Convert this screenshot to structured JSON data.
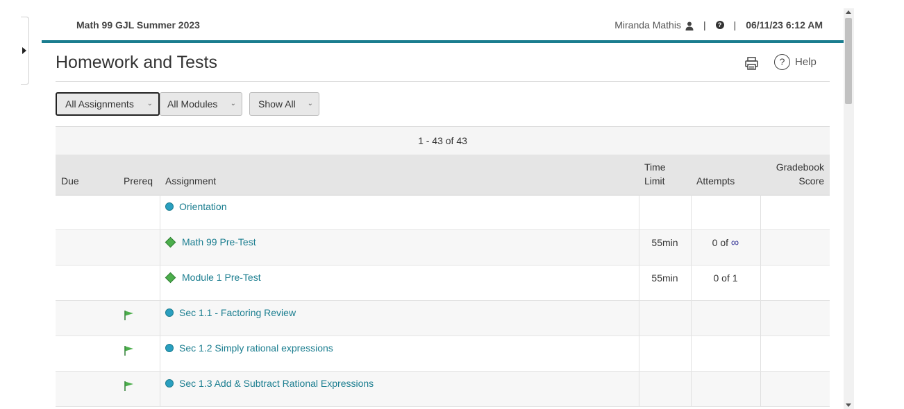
{
  "header": {
    "course_title": "Math 99 GJL Summer 2023",
    "user_name": "Miranda Mathis",
    "separator": "|",
    "help_glyph": "?",
    "datetime": "06/11/23 6:12 AM",
    "accent_color": "#1a7d8f"
  },
  "page": {
    "title": "Homework and Tests",
    "help_label": "Help"
  },
  "filters": {
    "assignments": "All Assignments",
    "modules": "All Modules",
    "show": "Show All"
  },
  "pager": {
    "text": "1 - 43 of 43"
  },
  "columns": {
    "due": "Due",
    "prereq": "Prereq",
    "assignment": "Assignment",
    "time_limit": "Time\nLimit",
    "attempts": "Attempts",
    "gradebook": "Gradebook\nScore"
  },
  "rows": [
    {
      "name": "Orientation",
      "icon": "circle-icon",
      "prereq": false,
      "time_limit": "",
      "attempts": "",
      "infinite": false
    },
    {
      "name": "Math 99 Pre-Test",
      "icon": "diamond-icon",
      "prereq": false,
      "time_limit": "55min",
      "attempts": "0 of",
      "infinite": true,
      "infinity_symbol": "∞"
    },
    {
      "name": "Module 1 Pre-Test",
      "icon": "diamond-icon",
      "prereq": false,
      "time_limit": "55min",
      "attempts": "0 of 1",
      "infinite": false
    },
    {
      "name": "Sec 1.1 - Factoring Review",
      "icon": "circle-icon",
      "prereq": true,
      "time_limit": "",
      "attempts": "",
      "infinite": false
    },
    {
      "name": "Sec 1.2 Simply rational expressions",
      "icon": "circle-icon",
      "prereq": true,
      "time_limit": "",
      "attempts": "",
      "infinite": false
    },
    {
      "name": "Sec 1.3 Add & Subtract Rational Expressions",
      "icon": "circle-icon",
      "prereq": true,
      "time_limit": "",
      "attempts": "",
      "infinite": false
    }
  ]
}
